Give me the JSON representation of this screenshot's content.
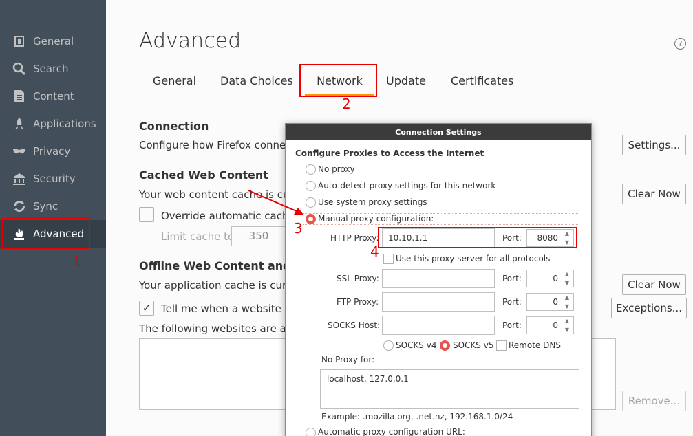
{
  "sidebar": {
    "items": [
      {
        "label": "General",
        "icon": "general-icon"
      },
      {
        "label": "Search",
        "icon": "search-icon"
      },
      {
        "label": "Content",
        "icon": "content-icon"
      },
      {
        "label": "Applications",
        "icon": "applications-icon"
      },
      {
        "label": "Privacy",
        "icon": "privacy-icon"
      },
      {
        "label": "Security",
        "icon": "security-icon"
      },
      {
        "label": "Sync",
        "icon": "sync-icon"
      },
      {
        "label": "Advanced",
        "icon": "advanced-icon",
        "selected": true
      }
    ]
  },
  "annotations": {
    "n1": "1",
    "n2": "2",
    "n3": "3",
    "n4": "4",
    "color": "#e60000"
  },
  "main": {
    "title": "Advanced",
    "help": "?",
    "tabs": [
      {
        "label": "General"
      },
      {
        "label": "Data Choices"
      },
      {
        "label": "Network",
        "selected": true
      },
      {
        "label": "Update"
      },
      {
        "label": "Certificates"
      }
    ],
    "connection": {
      "heading": "Connection",
      "desc": "Configure how Firefox connect",
      "settings_button": "Settings..."
    },
    "cache": {
      "heading": "Cached Web Content",
      "desc": "Your web content cache is curr",
      "clear_button": "Clear Now",
      "override_label": "Override automatic cache",
      "limit_label": "Limit cache to",
      "limit_value": "350"
    },
    "offline": {
      "heading": "Offline Web Content and U",
      "desc": "Your application cache is curre",
      "clear_button": "Clear Now",
      "tell_label": "Tell me when a website as",
      "tell_checked": "✓",
      "exceptions_button": "Exceptions...",
      "following": "The following websites are allo",
      "remove_button": "Remove..."
    }
  },
  "dialog": {
    "title": "Connection Settings",
    "heading": "Configure Proxies to Access the Internet",
    "options": {
      "no_proxy": "No proxy",
      "auto_detect": "Auto-detect proxy settings for this network",
      "system": "Use system proxy settings",
      "manual": "Manual proxy configuration:"
    },
    "http_label": "HTTP Proxy:",
    "http_value": "10.10.1.1",
    "port_label": "Port:",
    "http_port": "8080",
    "use_all": "Use this proxy server for all protocols",
    "ssl_label": "SSL Proxy:",
    "ssl_port": "0",
    "ftp_label": "FTP Proxy:",
    "ftp_port": "0",
    "socks_label": "SOCKS Host:",
    "socks_port": "0",
    "socks_v4": "SOCKS v4",
    "socks_v5": "SOCKS v5",
    "remote_dns": "Remote DNS",
    "no_proxy_for": "No Proxy for:",
    "no_proxy_value": "localhost, 127.0.0.1",
    "example": "Example: .mozilla.org, .net.nz, 192.168.1.0/24",
    "auto_config": "Automatic proxy configuration URL:"
  }
}
